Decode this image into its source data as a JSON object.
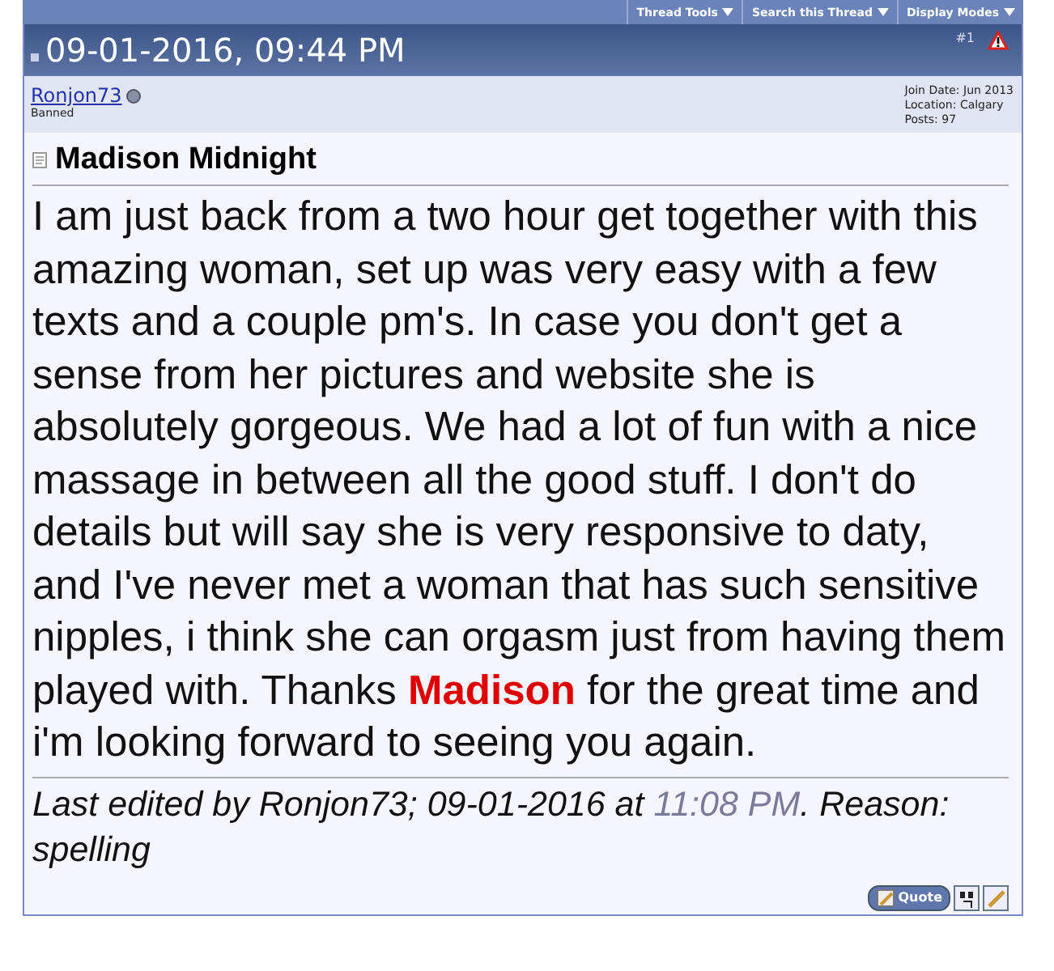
{
  "thread_menu": [
    {
      "label": "Thread Tools"
    },
    {
      "label": "Search this Thread"
    },
    {
      "label": "Display Modes"
    }
  ],
  "post": {
    "date": "09-01-2016, 09:44 PM",
    "number": "#1",
    "author": {
      "name": "Ronjon73",
      "status": "Banned",
      "online": false
    },
    "details": [
      "Join Date: Jun 2013",
      "Location: Calgary",
      "Posts: 97"
    ],
    "title": "Madison Midnight",
    "message": [
      {
        "text": "I am just back from a two hour get together with this amazing woman, set up was very easy with a few texts and a couple pm's. In case you don't get a sense from her pictures and website she is absolutely gorgeous. We had a lot of fun with a nice massage in between all the good stuff. I don't do details but will say she is very responsive to daty, and I've never met a woman that has such sensitive nipples, i think she can orgasm just from having them played with. Thanks ",
        "highlight": false
      },
      {
        "text": "Madison",
        "highlight": true
      },
      {
        "text": " for the great time and i'm looking forward to seeing you again.",
        "highlight": false
      }
    ],
    "edit_note": [
      {
        "text": "Last edited by Ronjon73; 09-01-2016 at ",
        "kind": "plain"
      },
      {
        "text": "11:08 PM",
        "kind": "time"
      },
      {
        "text": ". Reason: spelling",
        "kind": "plain"
      }
    ],
    "actions": [
      {
        "kind": "quote",
        "label": "Quote"
      },
      {
        "kind": "multiquote"
      },
      {
        "kind": "quickreply"
      }
    ]
  }
}
